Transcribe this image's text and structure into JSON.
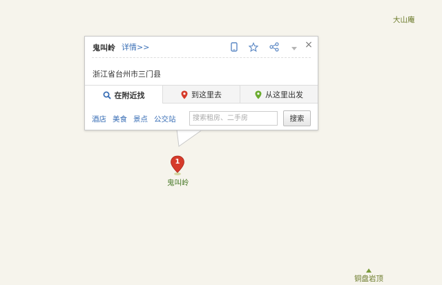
{
  "map": {
    "labels": {
      "top_right": "大山庵",
      "bottom_right": "铜盘岩顶",
      "marker": "鬼叫岭"
    },
    "marker_number": "1",
    "colors": {
      "background": "#f6f4ec",
      "marker_red": "#d63b2b",
      "label_green": "#4a7a2a"
    }
  },
  "popup": {
    "title": "鬼叫岭",
    "detail_link": "详情>>",
    "address": "浙江省台州市三门县",
    "header_icons": [
      "mobile-icon",
      "star-icon",
      "share-icon",
      "dropdown-icon",
      "close-icon"
    ],
    "close_symbol": "×",
    "tabs": [
      {
        "label": "在附近找",
        "icon": "search-icon",
        "active": true
      },
      {
        "label": "到这里去",
        "icon": "red-pin-icon",
        "active": false
      },
      {
        "label": "从这里出发",
        "icon": "green-pin-icon",
        "active": false
      }
    ],
    "categories": [
      "酒店",
      "美食",
      "景点",
      "公交站"
    ],
    "search": {
      "placeholder": "搜索租房、二手房",
      "button_label": "搜索"
    }
  }
}
